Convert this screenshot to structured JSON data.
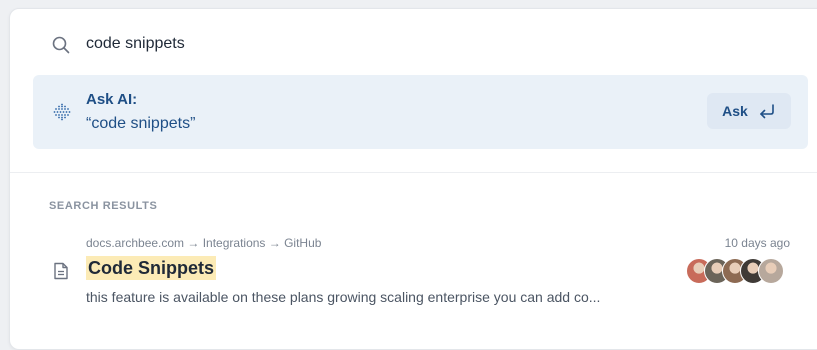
{
  "search": {
    "value": "code snippets"
  },
  "ask_ai": {
    "label": "Ask AI:",
    "query": "“code snippets”",
    "button_label": "Ask",
    "accent": "#1f4f86",
    "background": "#eaf1f8"
  },
  "results": {
    "section_title": "SEARCH RESULTS",
    "items": [
      {
        "breadcrumb": "docs.archbee.com → Integrations → GitHub",
        "title": "Code Snippets",
        "excerpt": "this feature is available on these plans growing scaling enterprise you can add co...",
        "timestamp": "10 days ago",
        "icon": "document-icon",
        "highlight": "#fcebb6",
        "avatars": [
          {
            "name": "avatar-1",
            "color": "#c86b5a"
          },
          {
            "name": "avatar-2",
            "color": "#6b6459"
          },
          {
            "name": "avatar-3",
            "color": "#8d6a52"
          },
          {
            "name": "avatar-4",
            "color": "#3f3a36"
          },
          {
            "name": "avatar-5",
            "color": "#b7a89c"
          }
        ]
      }
    ]
  }
}
